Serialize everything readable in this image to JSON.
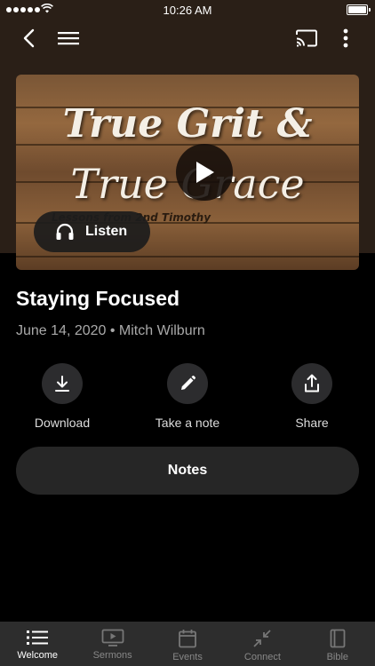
{
  "status_bar": {
    "time": "10:26 AM"
  },
  "header": {
    "back_icon": "chevron-left-icon",
    "menu_icon": "hamburger-icon",
    "cast_icon": "cast-icon",
    "more_icon": "more-vertical-icon"
  },
  "hero": {
    "title_line1": "True Grit &",
    "title_line2": "True Grace",
    "subtitle": "Lessons from 2nd Timothy",
    "listen_label": "Listen"
  },
  "sermon": {
    "title": "Staying Focused",
    "meta": "June 14, 2020 • Mitch Wilburn"
  },
  "actions": [
    {
      "label": "Download",
      "icon": "download-icon"
    },
    {
      "label": "Take a note",
      "icon": "pencil-icon"
    },
    {
      "label": "Share",
      "icon": "share-icon"
    }
  ],
  "notes_label": "Notes",
  "tabs": [
    {
      "label": "Welcome",
      "icon": "list-icon",
      "active": true
    },
    {
      "label": "Sermons",
      "icon": "play-screen-icon",
      "active": false
    },
    {
      "label": "Events",
      "icon": "calendar-icon",
      "active": false
    },
    {
      "label": "Connect",
      "icon": "collapse-arrows-icon",
      "active": false
    },
    {
      "label": "Bible",
      "icon": "book-icon",
      "active": false
    }
  ],
  "colors": {
    "background": "#000000",
    "header_bg": "#2a1f17",
    "button_bg": "#2c2c2e",
    "tab_bar_bg": "#2d2d2d",
    "meta_text": "#a9a9a9"
  }
}
